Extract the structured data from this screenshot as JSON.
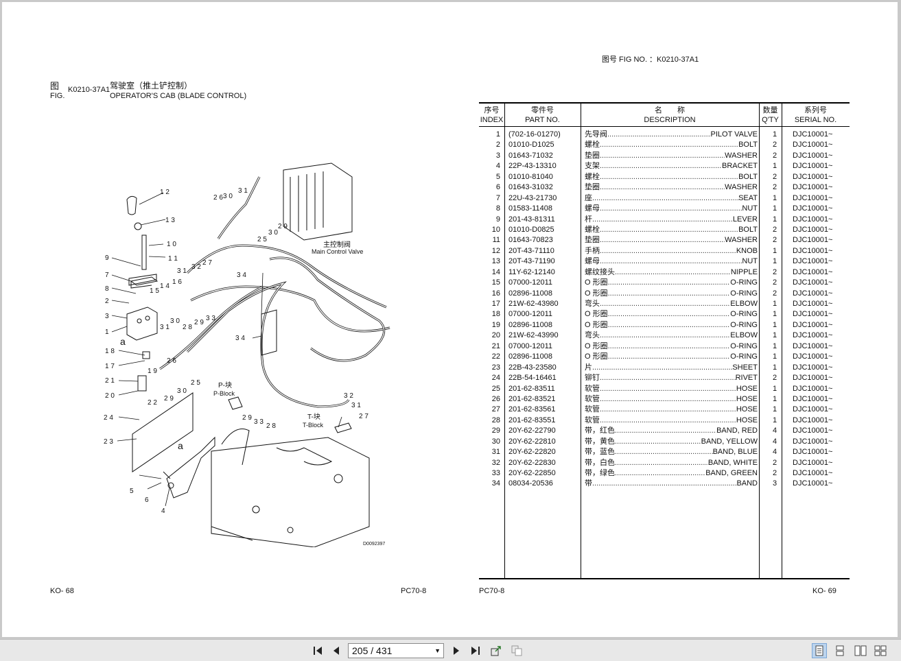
{
  "left_page": {
    "fig_label_cn": "图",
    "fig_label_en": "FIG.",
    "fig_no": "K0210-37A1",
    "title_cn": "驾驶室（推土铲控制）",
    "title_en": "OPERATOR'S CAB (BLADE CONTROL)",
    "footer_left": "KO-   68",
    "footer_right": "PC70-8"
  },
  "diagram": {
    "labels": {
      "main_valve_cn": "主控制阀",
      "main_valve_en": "Main Control Valve",
      "p_block_cn": "P-块",
      "p_block_en": "P-Block",
      "t_block_cn": "T-块",
      "t_block_en": "T-Block",
      "drawing_no": "D0092397",
      "a1": "a",
      "a2": "a"
    },
    "callouts": [
      "12",
      "13",
      "10",
      "11",
      "9",
      "7",
      "8",
      "2",
      "3",
      "1",
      "18",
      "17",
      "21",
      "20",
      "24",
      "23",
      "5",
      "6",
      "4",
      "14",
      "15",
      "16",
      "31",
      "32",
      "27",
      "28",
      "29",
      "33",
      "30",
      "26",
      "25",
      "34",
      "30",
      "31",
      "26",
      "25",
      "29",
      "30",
      "32",
      "31",
      "27",
      "29",
      "33",
      "28",
      "30",
      "22",
      "19"
    ]
  },
  "right_page": {
    "fig_no_label": "图号 FIG NO. ：K0210-37A1",
    "footer_left": "PC70-8",
    "footer_right": "KO-   69"
  },
  "table": {
    "headers": {
      "index_cn": "序号",
      "index_en": "INDEX",
      "part_cn": "零件号",
      "part_en": "PART NO.",
      "desc_cn": "名　　称",
      "desc_en": "DESCRIPTION",
      "qty_cn": "数量",
      "qty_en": "Q'TY",
      "serial_cn": "系列号",
      "serial_en": "SERIAL NO."
    },
    "rows": [
      {
        "index": "1",
        "part": "(702-16-01270)",
        "cn": "先导阀",
        "en": "PILOT VALVE",
        "qty": "1",
        "serial": "DJC10001~"
      },
      {
        "index": "2",
        "part": "01010-D1025",
        "cn": "螺栓",
        "en": "BOLT",
        "qty": "2",
        "serial": "DJC10001~"
      },
      {
        "index": "3",
        "part": "01643-71032",
        "cn": "垫圈",
        "en": "WASHER",
        "qty": "2",
        "serial": "DJC10001~"
      },
      {
        "index": "4",
        "part": "22P-43-13310",
        "cn": "支架",
        "en": "BRACKET",
        "qty": "1",
        "serial": "DJC10001~"
      },
      {
        "index": "5",
        "part": "01010-81040",
        "cn": "螺栓",
        "en": "BOLT",
        "qty": "2",
        "serial": "DJC10001~"
      },
      {
        "index": "6",
        "part": "01643-31032",
        "cn": "垫圈",
        "en": "WASHER",
        "qty": "2",
        "serial": "DJC10001~"
      },
      {
        "index": "7",
        "part": "22U-43-21730",
        "cn": "座",
        "en": "SEAT",
        "qty": "1",
        "serial": "DJC10001~"
      },
      {
        "index": "8",
        "part": "01583-11408",
        "cn": "螺母",
        "en": "NUT",
        "qty": "1",
        "serial": "DJC10001~"
      },
      {
        "index": "9",
        "part": "201-43-81311",
        "cn": "杆",
        "en": "LEVER",
        "qty": "1",
        "serial": "DJC10001~"
      },
      {
        "index": "10",
        "part": "01010-D0825",
        "cn": "螺栓",
        "en": "BOLT",
        "qty": "2",
        "serial": "DJC10001~"
      },
      {
        "index": "11",
        "part": "01643-70823",
        "cn": "垫圈",
        "en": "WASHER",
        "qty": "2",
        "serial": "DJC10001~"
      },
      {
        "index": "12",
        "part": "20T-43-71110",
        "cn": "手柄",
        "en": "KNOB",
        "qty": "1",
        "serial": "DJC10001~"
      },
      {
        "index": "13",
        "part": "20T-43-71190",
        "cn": "螺母",
        "en": "NUT",
        "qty": "1",
        "serial": "DJC10001~"
      },
      {
        "index": "14",
        "part": "11Y-62-12140",
        "cn": "螺纹接头",
        "en": "NIPPLE",
        "qty": "2",
        "serial": "DJC10001~"
      },
      {
        "index": "15",
        "part": "07000-12011",
        "cn": "O 形圈",
        "en": "O-RING",
        "qty": "2",
        "serial": "DJC10001~"
      },
      {
        "index": "16",
        "part": "02896-11008",
        "cn": "O 形圈",
        "en": "O-RING",
        "qty": "2",
        "serial": "DJC10001~"
      },
      {
        "index": "17",
        "part": "21W-62-43980",
        "cn": "弯头",
        "en": "ELBOW",
        "qty": "1",
        "serial": "DJC10001~"
      },
      {
        "index": "18",
        "part": "07000-12011",
        "cn": "O 形圈",
        "en": "O-RING",
        "qty": "1",
        "serial": "DJC10001~"
      },
      {
        "index": "19",
        "part": "02896-11008",
        "cn": "O 形圈",
        "en": "O-RING",
        "qty": "1",
        "serial": "DJC10001~"
      },
      {
        "index": "20",
        "part": "21W-62-43990",
        "cn": "弯头",
        "en": "ELBOW",
        "qty": "1",
        "serial": "DJC10001~"
      },
      {
        "index": "21",
        "part": "07000-12011",
        "cn": "O 形圈",
        "en": "O-RING",
        "qty": "1",
        "serial": "DJC10001~"
      },
      {
        "index": "22",
        "part": "02896-11008",
        "cn": "O 形圈",
        "en": "O-RING",
        "qty": "1",
        "serial": "DJC10001~"
      },
      {
        "index": "23",
        "part": "22B-43-23580",
        "cn": "片",
        "en": "SHEET",
        "qty": "1",
        "serial": "DJC10001~"
      },
      {
        "index": "24",
        "part": "22B-54-16461",
        "cn": "铆钉",
        "en": "RIVET",
        "qty": "2",
        "serial": "DJC10001~"
      },
      {
        "index": "25",
        "part": "201-62-83511",
        "cn": "软管",
        "en": "HOSE",
        "qty": "1",
        "serial": "DJC10001~"
      },
      {
        "index": "26",
        "part": "201-62-83521",
        "cn": "软管",
        "en": "HOSE",
        "qty": "1",
        "serial": "DJC10001~"
      },
      {
        "index": "27",
        "part": "201-62-83561",
        "cn": "软管",
        "en": "HOSE",
        "qty": "1",
        "serial": "DJC10001~"
      },
      {
        "index": "28",
        "part": "201-62-83551",
        "cn": "软管",
        "en": "HOSE",
        "qty": "1",
        "serial": "DJC10001~"
      },
      {
        "index": "29",
        "part": "20Y-62-22790",
        "cn": "带，红色",
        "en": "BAND, RED",
        "qty": "4",
        "serial": "DJC10001~"
      },
      {
        "index": "30",
        "part": "20Y-62-22810",
        "cn": "带，黄色",
        "en": "BAND, YELLOW",
        "qty": "4",
        "serial": "DJC10001~"
      },
      {
        "index": "31",
        "part": "20Y-62-22820",
        "cn": "带，蓝色",
        "en": "BAND, BLUE",
        "qty": "4",
        "serial": "DJC10001~"
      },
      {
        "index": "32",
        "part": "20Y-62-22830",
        "cn": "带，白色",
        "en": "BAND, WHITE",
        "qty": "2",
        "serial": "DJC10001~"
      },
      {
        "index": "33",
        "part": "20Y-62-22850",
        "cn": "带，绿色",
        "en": "BAND, GREEN",
        "qty": "2",
        "serial": "DJC10001~"
      },
      {
        "index": "34",
        "part": "08034-20536",
        "cn": "带",
        "en": "BAND",
        "qty": "3",
        "serial": "DJC10001~"
      }
    ]
  },
  "toolbar": {
    "page_current": "205",
    "page_total": "431",
    "page_text": "205 / 431",
    "icons": [
      "first-page-icon",
      "prev-page-icon",
      "next-page-icon",
      "last-page-icon",
      "export-icon",
      "copy-icon",
      "single-page-view-icon",
      "continuous-view-icon",
      "two-page-view-icon",
      "two-page-continuous-view-icon"
    ]
  }
}
